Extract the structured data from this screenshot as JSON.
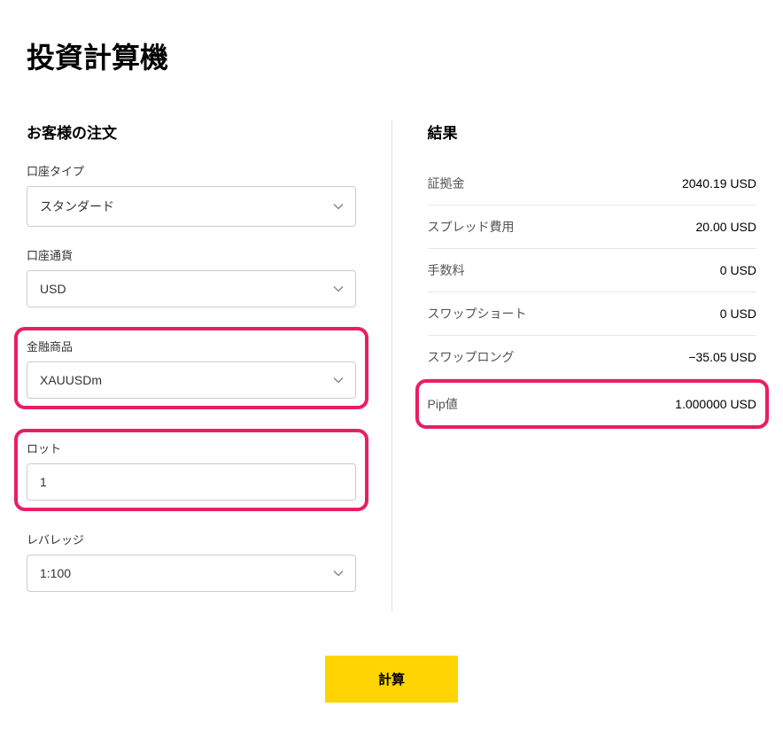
{
  "title": "投資計算機",
  "order": {
    "section_title": "お客様の注文",
    "account_type": {
      "label": "口座タイプ",
      "value": "スタンダード"
    },
    "account_currency": {
      "label": "口座通貨",
      "value": "USD"
    },
    "instrument": {
      "label": "金融商品",
      "value": "XAUUSDm"
    },
    "lot": {
      "label": "ロット",
      "value": "1"
    },
    "leverage": {
      "label": "レバレッジ",
      "value": "1:100"
    }
  },
  "results": {
    "section_title": "結果",
    "margin": {
      "label": "証拠金",
      "value": "2040.19 USD"
    },
    "spread_cost": {
      "label": "スプレッド費用",
      "value": "20.00 USD"
    },
    "commission": {
      "label": "手数料",
      "value": "0 USD"
    },
    "swap_short": {
      "label": "スワップショート",
      "value": "0 USD"
    },
    "swap_long": {
      "label": "スワップロング",
      "value": "−35.05 USD"
    },
    "pip_value": {
      "label": "Pip値",
      "value": "1.000000 USD"
    }
  },
  "calculate_button": "計算"
}
